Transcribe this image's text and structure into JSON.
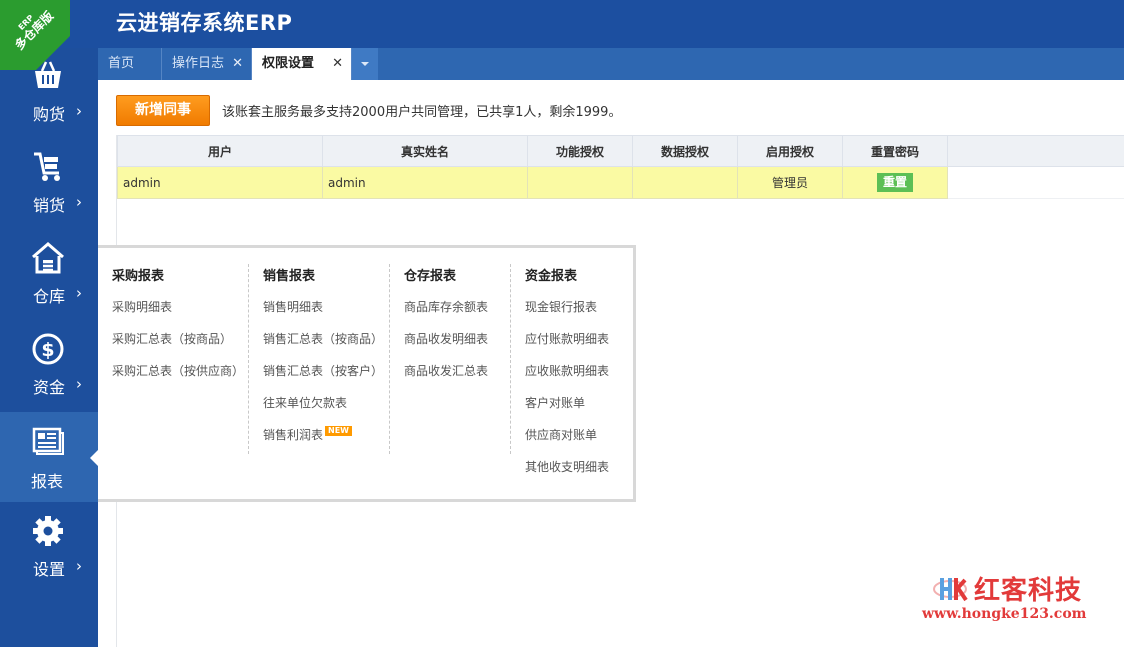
{
  "app": {
    "title": "云进销存系统ERP",
    "ribbon_small": "ERP",
    "ribbon_big": "多仓库版"
  },
  "tabs": [
    {
      "label": "首页",
      "closable": false,
      "active": false
    },
    {
      "label": "操作日志",
      "closable": true,
      "active": false
    },
    {
      "label": "权限设置",
      "closable": true,
      "active": true
    }
  ],
  "tab_close_glyph": "✕",
  "sidebar": {
    "items": [
      {
        "label": "购货",
        "icon": "basket-icon",
        "arrow": "›"
      },
      {
        "label": "销货",
        "icon": "cart-icon",
        "arrow": "›"
      },
      {
        "label": "仓库",
        "icon": "warehouse-icon",
        "arrow": "›"
      },
      {
        "label": "资金",
        "icon": "dollar-icon",
        "arrow": "›"
      },
      {
        "label": "报表",
        "icon": "report-icon",
        "active": true
      },
      {
        "label": "设置",
        "icon": "gear-icon",
        "arrow": "›"
      }
    ]
  },
  "toolbar": {
    "add_label": "新增同事",
    "notice": "该账套主服务最多支持2000用户共同管理，已共享1人，剩余1999。"
  },
  "table": {
    "headers": [
      "用户",
      "真实姓名",
      "功能授权",
      "数据授权",
      "启用授权",
      "重置密码"
    ],
    "rows": [
      {
        "user": "admin",
        "real_name": "admin",
        "func_auth": "",
        "data_auth": "",
        "enabled": "管理员",
        "reset": "重置"
      }
    ]
  },
  "report_menu": {
    "columns": [
      {
        "title": "采购报表",
        "items": [
          "采购明细表",
          "采购汇总表（按商品）",
          "采购汇总表（按供应商）"
        ]
      },
      {
        "title": "销售报表",
        "items": [
          "销售明细表",
          "销售汇总表（按商品）",
          "销售汇总表（按客户）",
          "往来单位欠款表",
          "销售利润表"
        ],
        "badge": "NEW"
      },
      {
        "title": "仓存报表",
        "items": [
          "商品库存余额表",
          "商品收发明细表",
          "商品收发汇总表"
        ]
      },
      {
        "title": "资金报表",
        "items": [
          "现金银行报表",
          "应付账款明细表",
          "应收账款明细表",
          "客户对账单",
          "供应商对账单",
          "其他收支明细表"
        ]
      }
    ]
  },
  "watermark": {
    "text": "红客科技",
    "url": "www.hongke123.com"
  },
  "colors": {
    "header": "#1c4fa0",
    "sidebar": "#1d4f9d",
    "accent_orange": "#f07b00",
    "row_highlight": "#fafaa3",
    "green_button": "#5cbf55",
    "watermark_red": "#e23a3a"
  }
}
